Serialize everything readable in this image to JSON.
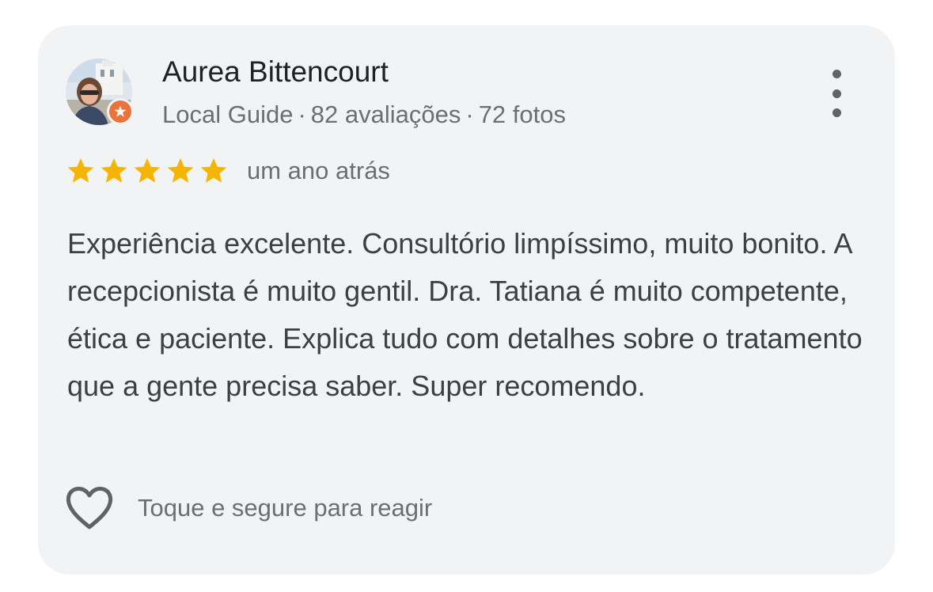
{
  "review": {
    "author_name": "Aurea Bittencourt",
    "author_role": "Local Guide",
    "reviews_count": "82 avaliações",
    "photos_count": "72 fotos",
    "separator": "·",
    "rating": 5,
    "rating_max": 5,
    "time_ago": "um ano atrás",
    "text": "Experiência excelente. Consultório limpíssimo, muito bonito. A recepcionista é muito gentil. Dra. Tatiana é muito competente, ética e paciente. Explica tudo com detalhes sobre o tratamento que a gente precisa saber. Super recomendo.",
    "react_label": "Toque e segure para reagir"
  },
  "colors": {
    "card_background": "#f2f3f5",
    "star": "#f4b400",
    "badge": "#e8743b"
  },
  "icons": {
    "more": "more-vertical-icon",
    "badge": "local-guide-badge-icon",
    "star": "star-icon",
    "heart": "heart-outline-icon"
  }
}
